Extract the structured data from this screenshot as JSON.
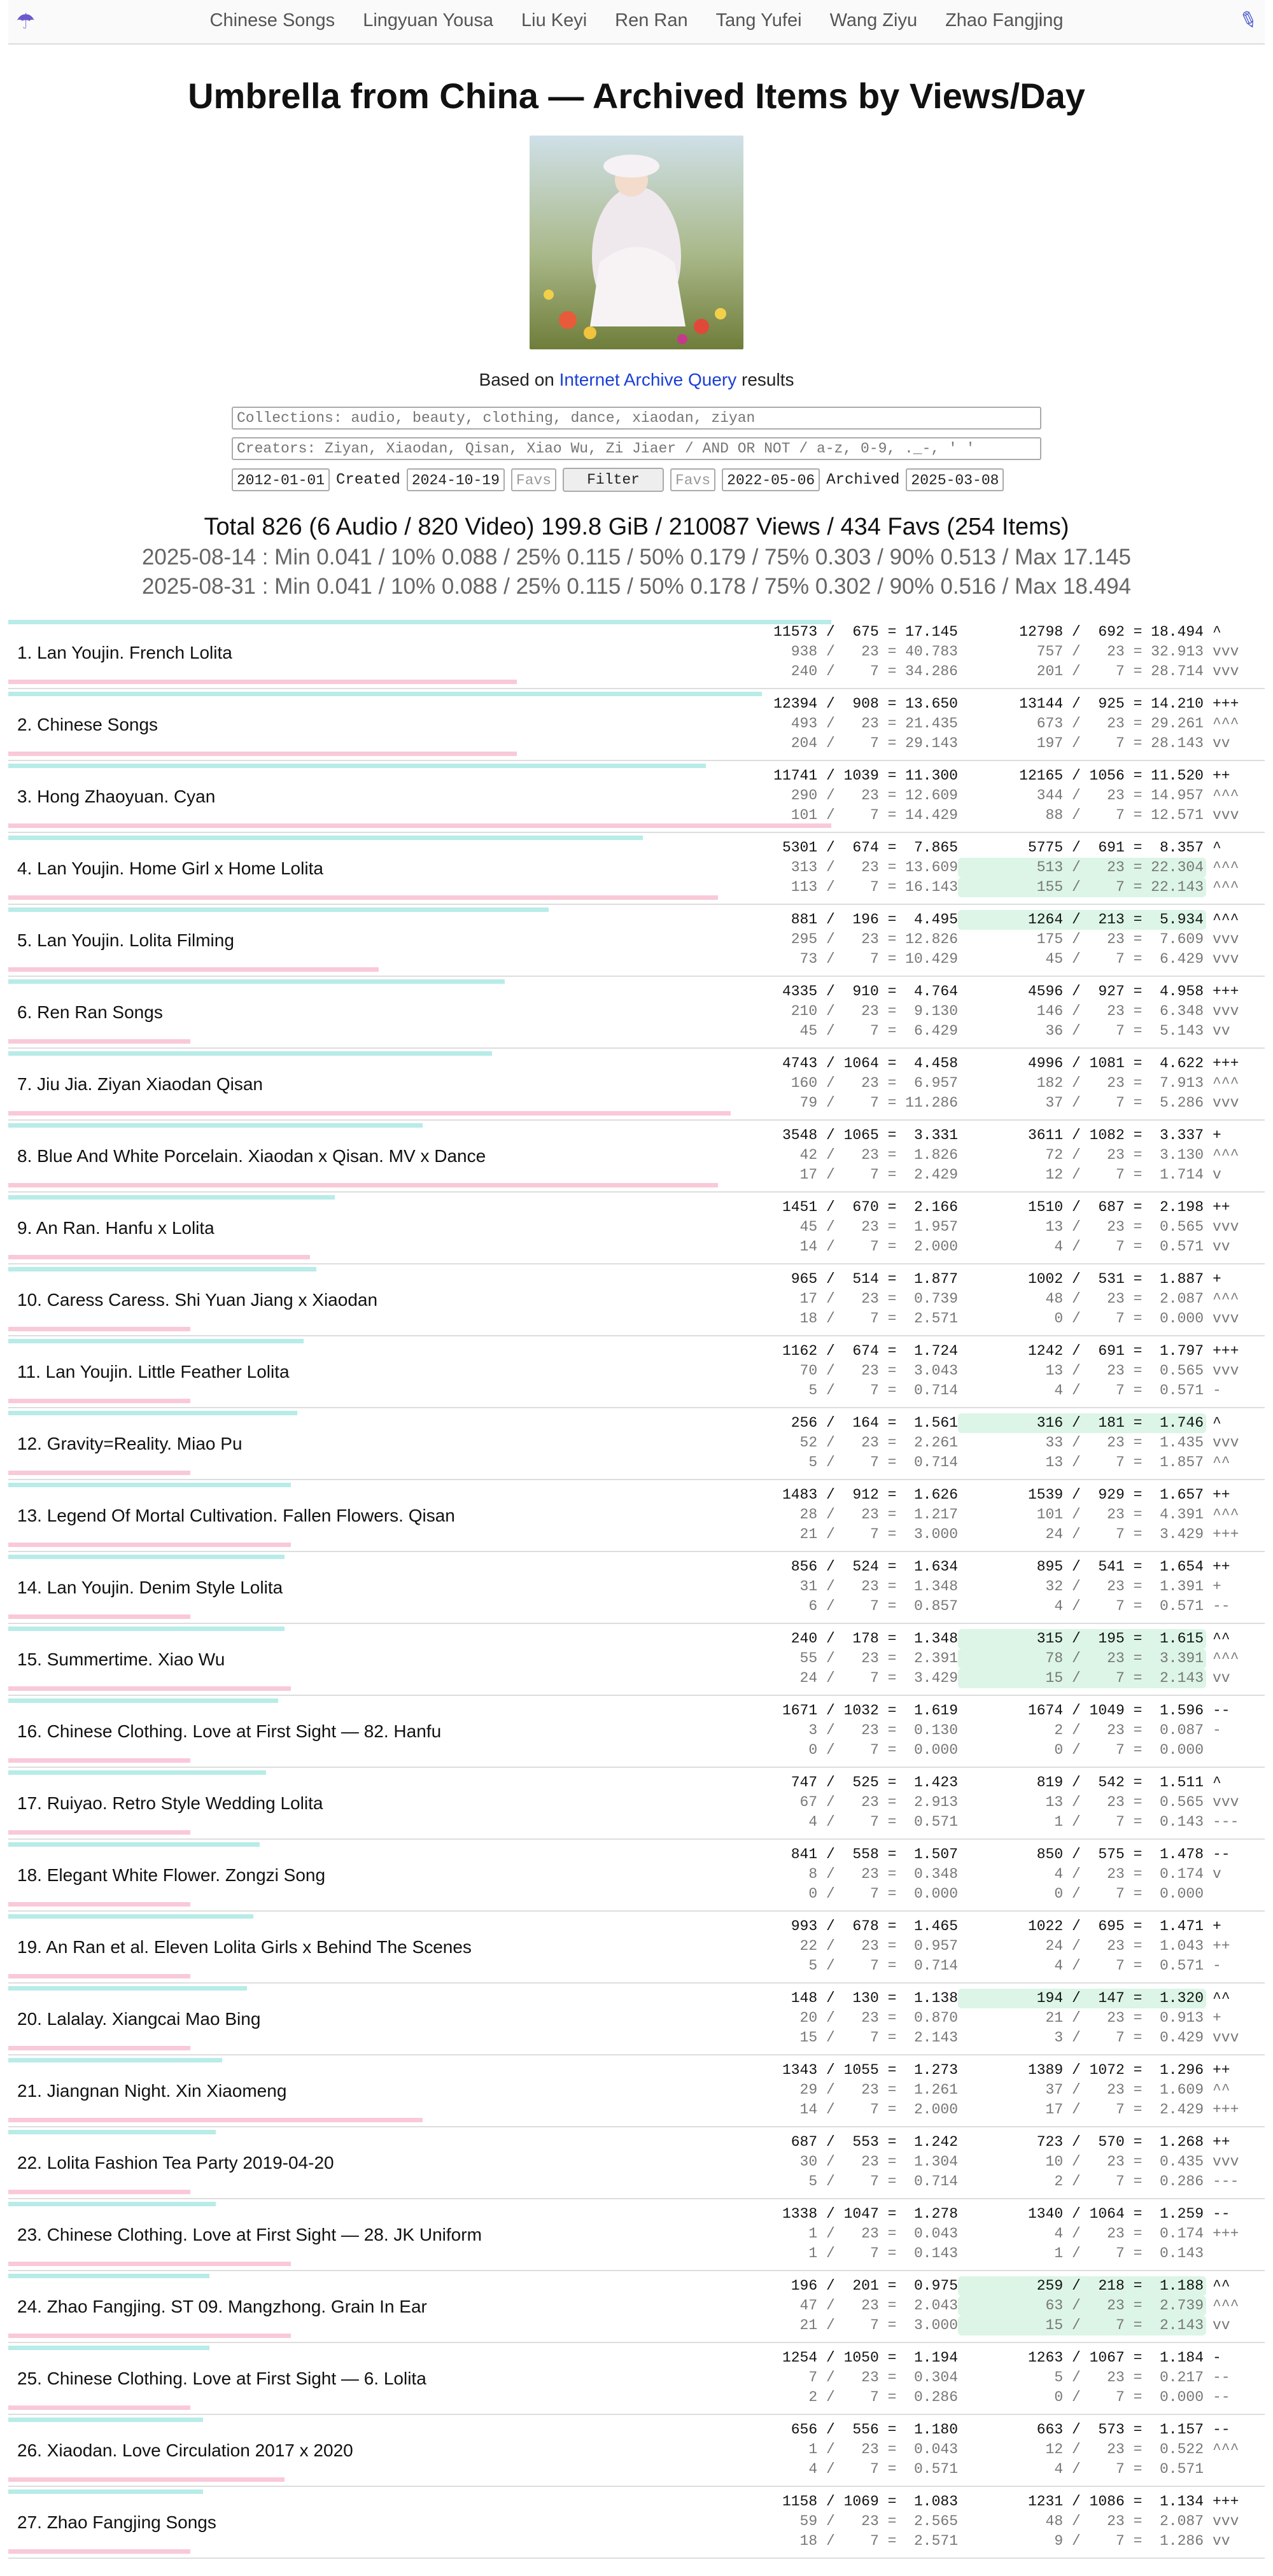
{
  "nav": {
    "items": [
      "Chinese Songs",
      "Lingyuan Yousa",
      "Liu Keyi",
      "Ren Ran",
      "Tang Yufei",
      "Wang Ziyu",
      "Zhao Fangjing"
    ]
  },
  "page_title": "Umbrella from China — Archived Items by Views/Day",
  "based": {
    "prefix": "Based on ",
    "link": "Internet Archive Query",
    "suffix": " results"
  },
  "form": {
    "collections_placeholder": "Collections: audio, beauty, clothing, dance, xiaodan, ziyan",
    "creators_placeholder": "Creators: Ziyan, Xiaodan, Qisan, Xiao Wu, Zi Jiaer / AND OR NOT / a-z, 0-9, ._-, ' '",
    "created_from": "2012-01-01",
    "created_label": "Created",
    "created_to": "2024-10-19",
    "favs_left": "Favs",
    "filter_label": "Filter",
    "favs_right": "Favs",
    "archived_from": "2022-05-06",
    "archived_label": "Archived",
    "archived_to": "2025-03-08"
  },
  "totals": "Total 826 (6 Audio / 820 Video) 199.8 GiB / 210087 Views / 434 Favs (254 Items)",
  "stats": [
    "2025-08-14 : Min 0.041 / 10% 0.088 / 25% 0.115 / 50% 0.179 / 75% 0.303 / 90% 0.513 / Max 17.145",
    "2025-08-31 : Min 0.041 / 10% 0.088 / 25% 0.115 / 50% 0.178 / 75% 0.302 / 90% 0.516 / Max 18.494"
  ],
  "items": [
    {
      "title": "1. Lan Youjin. French Lolita",
      "bar1": 0.655,
      "bar2": 0.405,
      "rows": [
        [
          "11573 /  675 = 17.145",
          "12798 /  692 = 18.494",
          "^",
          false
        ],
        [
          "  938 /   23 = 40.783",
          "  757 /   23 = 32.913",
          "vvv",
          false
        ],
        [
          "  240 /    7 = 34.286",
          "  201 /    7 = 28.714",
          "vvv",
          false
        ]
      ]
    },
    {
      "title": "2. Chinese Songs",
      "bar1": 0.6,
      "bar2": 0.405,
      "rows": [
        [
          "12394 /  908 = 13.650",
          "13144 /  925 = 14.210",
          "+++",
          false
        ],
        [
          "  493 /   23 = 21.435",
          "  673 /   23 = 29.261",
          "^^^",
          false
        ],
        [
          "  204 /    7 = 29.143",
          "  197 /    7 = 28.143",
          "vv",
          false
        ]
      ]
    },
    {
      "title": "3. Hong Zhaoyuan. Cyan",
      "bar1": 0.555,
      "bar2": 0.655,
      "rows": [
        [
          "11741 / 1039 = 11.300",
          "12165 / 1056 = 11.520",
          "++",
          false
        ],
        [
          "  290 /   23 = 12.609",
          "  344 /   23 = 14.957",
          "^^^",
          false
        ],
        [
          "  101 /    7 = 14.429",
          "   88 /    7 = 12.571",
          "vvv",
          false
        ]
      ]
    },
    {
      "title": "4. Lan Youjin. Home Girl x Home Lolita",
      "bar1": 0.505,
      "bar2": 0.565,
      "rows": [
        [
          "5301 /  674 =  7.865",
          "5775 /  691 =  8.357",
          "^",
          false
        ],
        [
          " 313 /   23 = 13.609",
          " 513 /   23 = 22.304",
          "^^^",
          true
        ],
        [
          " 113 /    7 = 16.143",
          " 155 /    7 = 22.143",
          "^^^",
          true
        ]
      ]
    },
    {
      "title": "5. Lan Youjin. Lolita Filming",
      "bar1": 0.43,
      "bar2": 0.295,
      "rows": [
        [
          " 881 /  196 =  4.495",
          "1264 /  213 =  5.934",
          "^^^",
          true
        ],
        [
          " 295 /   23 = 12.826",
          " 175 /   23 =  7.609",
          "vvv",
          false
        ],
        [
          "  73 /    7 = 10.429",
          "  45 /    7 =  6.429",
          "vvv",
          false
        ]
      ]
    },
    {
      "title": "6. Ren Ran Songs",
      "bar1": 0.395,
      "bar2": 0.145,
      "rows": [
        [
          "4335 /  910 =  4.764",
          "4596 /  927 =  4.958",
          "+++",
          false
        ],
        [
          " 210 /   23 =  9.130",
          " 146 /   23 =  6.348",
          "vvv",
          false
        ],
        [
          "  45 /    7 =  6.429",
          "  36 /    7 =  5.143",
          "vv",
          false
        ]
      ]
    },
    {
      "title": "7. Jiu Jia. Ziyan Xiaodan Qisan",
      "bar1": 0.385,
      "bar2": 0.575,
      "rows": [
        [
          "4743 / 1064 =  4.458",
          "4996 / 1081 =  4.622",
          "+++",
          false
        ],
        [
          " 160 /   23 =  6.957",
          " 182 /   23 =  7.913",
          "^^^",
          false
        ],
        [
          "  79 /    7 = 11.286",
          "  37 /    7 =  5.286",
          "vvv",
          false
        ]
      ]
    },
    {
      "title": "8. Blue And White Porcelain. Xiaodan x Qisan. MV x Dance",
      "bar1": 0.33,
      "bar2": 0.565,
      "rows": [
        [
          "3548 / 1065 =  3.331",
          "3611 / 1082 =  3.337",
          "+",
          false
        ],
        [
          "  42 /   23 =  1.826",
          "  72 /   23 =  3.130",
          "^^^",
          false
        ],
        [
          "  17 /    7 =  2.429",
          "  12 /    7 =  1.714",
          "v",
          false
        ]
      ]
    },
    {
      "title": "9. An Ran. Hanfu x Lolita",
      "bar1": 0.26,
      "bar2": 0.24,
      "rows": [
        [
          "1451 /  670 =  2.166",
          "1510 /  687 =  2.198",
          "++",
          false
        ],
        [
          "  45 /   23 =  1.957",
          "  13 /   23 =  0.565",
          "vvv",
          false
        ],
        [
          "  14 /    7 =  2.000",
          "   4 /    7 =  0.571",
          "vv",
          false
        ]
      ]
    },
    {
      "title": "10. Caress Caress. Shi Yuan Jiang x Xiaodan",
      "bar1": 0.245,
      "bar2": 0.145,
      "rows": [
        [
          " 965 /  514 =  1.877",
          "1002 /  531 =  1.887",
          "+",
          false
        ],
        [
          "  17 /   23 =  0.739",
          "  48 /   23 =  2.087",
          "^^^",
          false
        ],
        [
          "  18 /    7 =  2.571",
          "   0 /    7 =  0.000",
          "vvv",
          false
        ]
      ]
    },
    {
      "title": "11. Lan Youjin. Little Feather Lolita",
      "bar1": 0.235,
      "bar2": 0.145,
      "rows": [
        [
          "1162 /  674 =  1.724",
          "1242 /  691 =  1.797",
          "+++",
          false
        ],
        [
          "  70 /   23 =  3.043",
          "  13 /   23 =  0.565",
          "vvv",
          false
        ],
        [
          "   5 /    7 =  0.714",
          "   4 /    7 =  0.571",
          "-",
          false
        ]
      ]
    },
    {
      "title": "12. Gravity=Reality. Miao Pu",
      "bar1": 0.23,
      "bar2": 0.145,
      "rows": [
        [
          " 256 /  164 =  1.561",
          " 316 /  181 =  1.746",
          "^",
          true
        ],
        [
          "  52 /   23 =  2.261",
          "  33 /   23 =  1.435",
          "vvv",
          false
        ],
        [
          "   5 /    7 =  0.714",
          "  13 /    7 =  1.857",
          "^^",
          false
        ]
      ]
    },
    {
      "title": "13. Legend Of Mortal Cultivation. Fallen Flowers. Qisan",
      "bar1": 0.225,
      "bar2": 0.225,
      "rows": [
        [
          "1483 /  912 =  1.626",
          "1539 /  929 =  1.657",
          "++",
          false
        ],
        [
          "  28 /   23 =  1.217",
          " 101 /   23 =  4.391",
          "^^^",
          false
        ],
        [
          "  21 /    7 =  3.000",
          "  24 /    7 =  3.429",
          "+++",
          false
        ]
      ]
    },
    {
      "title": "14. Lan Youjin. Denim Style Lolita",
      "bar1": 0.22,
      "bar2": 0.145,
      "rows": [
        [
          " 856 /  524 =  1.634",
          " 895 /  541 =  1.654",
          "++",
          false
        ],
        [
          "  31 /   23 =  1.348",
          "  32 /   23 =  1.391",
          "+",
          false
        ],
        [
          "   6 /    7 =  0.857",
          "   4 /    7 =  0.571",
          "--",
          false
        ]
      ]
    },
    {
      "title": "15. Summertime. Xiao Wu",
      "bar1": 0.22,
      "bar2": 0.225,
      "rows": [
        [
          " 240 /  178 =  1.348",
          " 315 /  195 =  1.615",
          "^^",
          true
        ],
        [
          "  55 /   23 =  2.391",
          "  78 /   23 =  3.391",
          "^^^",
          true
        ],
        [
          "  24 /    7 =  3.429",
          "  15 /    7 =  2.143",
          "vv",
          true
        ]
      ]
    },
    {
      "title": "16. Chinese Clothing. Love at First Sight — 82. Hanfu",
      "bar1": 0.215,
      "bar2": 0.145,
      "rows": [
        [
          "1671 / 1032 =  1.619",
          "1674 / 1049 =  1.596",
          "--",
          false
        ],
        [
          "   3 /   23 =  0.130",
          "   2 /   23 =  0.087",
          "-",
          false
        ],
        [
          "   0 /    7 =  0.000",
          "   0 /    7 =  0.000",
          "",
          false
        ]
      ]
    },
    {
      "title": "17. Ruiyao. Retro Style Wedding Lolita",
      "bar1": 0.205,
      "bar2": 0.145,
      "rows": [
        [
          " 747 /  525 =  1.423",
          " 819 /  542 =  1.511",
          "^",
          false
        ],
        [
          "  67 /   23 =  2.913",
          "  13 /   23 =  0.565",
          "vvv",
          false
        ],
        [
          "   4 /    7 =  0.571",
          "   1 /    7 =  0.143",
          "---",
          false
        ]
      ]
    },
    {
      "title": "18. Elegant White Flower. Zongzi Song",
      "bar1": 0.2,
      "bar2": 0.145,
      "rows": [
        [
          " 841 /  558 =  1.507",
          " 850 /  575 =  1.478",
          "--",
          false
        ],
        [
          "   8 /   23 =  0.348",
          "   4 /   23 =  0.174",
          "v",
          false
        ],
        [
          "   0 /    7 =  0.000",
          "   0 /    7 =  0.000",
          "",
          false
        ]
      ]
    },
    {
      "title": "19. An Ran et al. Eleven Lolita Girls x Behind The Scenes",
      "bar1": 0.195,
      "bar2": 0.145,
      "rows": [
        [
          " 993 /  678 =  1.465",
          "1022 /  695 =  1.471",
          "+",
          false
        ],
        [
          "  22 /   23 =  0.957",
          "  24 /   23 =  1.043",
          "++",
          false
        ],
        [
          "   5 /    7 =  0.714",
          "   4 /    7 =  0.571",
          "-",
          false
        ]
      ]
    },
    {
      "title": "20. Lalalay. Xiangcai Mao Bing",
      "bar1": 0.19,
      "bar2": 0.145,
      "rows": [
        [
          " 148 /  130 =  1.138",
          " 194 /  147 =  1.320",
          "^^",
          true
        ],
        [
          "  20 /   23 =  0.870",
          "  21 /   23 =  0.913",
          "+",
          false
        ],
        [
          "  15 /    7 =  2.143",
          "   3 /    7 =  0.429",
          "vvv",
          false
        ]
      ]
    },
    {
      "title": "21. Jiangnan Night. Xin Xiaomeng",
      "bar1": 0.17,
      "bar2": 0.33,
      "rows": [
        [
          "1343 / 1055 =  1.273",
          "1389 / 1072 =  1.296",
          "++",
          false
        ],
        [
          "  29 /   23 =  1.261",
          "  37 /   23 =  1.609",
          "^^",
          false
        ],
        [
          "  14 /    7 =  2.000",
          "  17 /    7 =  2.429",
          "+++",
          false
        ]
      ]
    },
    {
      "title": "22. Lolita Fashion Tea Party 2019-04-20",
      "bar1": 0.165,
      "bar2": 0.145,
      "rows": [
        [
          " 687 /  553 =  1.242",
          " 723 /  570 =  1.268",
          "++",
          false
        ],
        [
          "  30 /   23 =  1.304",
          "  10 /   23 =  0.435",
          "vvv",
          false
        ],
        [
          "   5 /    7 =  0.714",
          "   2 /    7 =  0.286",
          "---",
          false
        ]
      ]
    },
    {
      "title": "23. Chinese Clothing. Love at First Sight — 28. JK Uniform",
      "bar1": 0.165,
      "bar2": 0.225,
      "rows": [
        [
          "1338 / 1047 =  1.278",
          "1340 / 1064 =  1.259",
          "--",
          false
        ],
        [
          "   1 /   23 =  0.043",
          "   4 /   23 =  0.174",
          "+++",
          false
        ],
        [
          "   1 /    7 =  0.143",
          "   1 /    7 =  0.143",
          "",
          false
        ]
      ]
    },
    {
      "title": "24. Zhao Fangjing. ST 09. Mangzhong. Grain In Ear",
      "bar1": 0.16,
      "bar2": 0.225,
      "rows": [
        [
          " 196 /  201 =  0.975",
          " 259 /  218 =  1.188",
          "^^",
          true
        ],
        [
          "  47 /   23 =  2.043",
          "  63 /   23 =  2.739",
          "^^^",
          true
        ],
        [
          "  21 /    7 =  3.000",
          "  15 /    7 =  2.143",
          "vv",
          true
        ]
      ]
    },
    {
      "title": "25. Chinese Clothing. Love at First Sight — 6. Lolita",
      "bar1": 0.16,
      "bar2": 0.145,
      "rows": [
        [
          "1254 / 1050 =  1.194",
          "1263 / 1067 =  1.184",
          "-",
          false
        ],
        [
          "   7 /   23 =  0.304",
          "   5 /   23 =  0.217",
          "--",
          false
        ],
        [
          "   2 /    7 =  0.286",
          "   0 /    7 =  0.000",
          "--",
          false
        ]
      ]
    },
    {
      "title": "26. Xiaodan. Love Circulation 2017 x 2020",
      "bar1": 0.155,
      "bar2": 0.22,
      "rows": [
        [
          " 656 /  556 =  1.180",
          " 663 /  573 =  1.157",
          "--",
          false
        ],
        [
          "   1 /   23 =  0.043",
          "  12 /   23 =  0.522",
          "^^^",
          false
        ],
        [
          "   4 /    7 =  0.571",
          "   4 /    7 =  0.571",
          "",
          false
        ]
      ]
    },
    {
      "title": "27. Zhao Fangjing Songs",
      "bar1": 0.155,
      "bar2": 0.145,
      "rows": [
        [
          "1158 / 1069 =  1.083",
          "1231 / 1086 =  1.134",
          "+++",
          false
        ],
        [
          "  59 /   23 =  2.565",
          "  48 /   23 =  2.087",
          "vvv",
          false
        ],
        [
          "  18 /    7 =  2.571",
          "   9 /    7 =  1.286",
          "vv",
          false
        ]
      ]
    }
  ]
}
